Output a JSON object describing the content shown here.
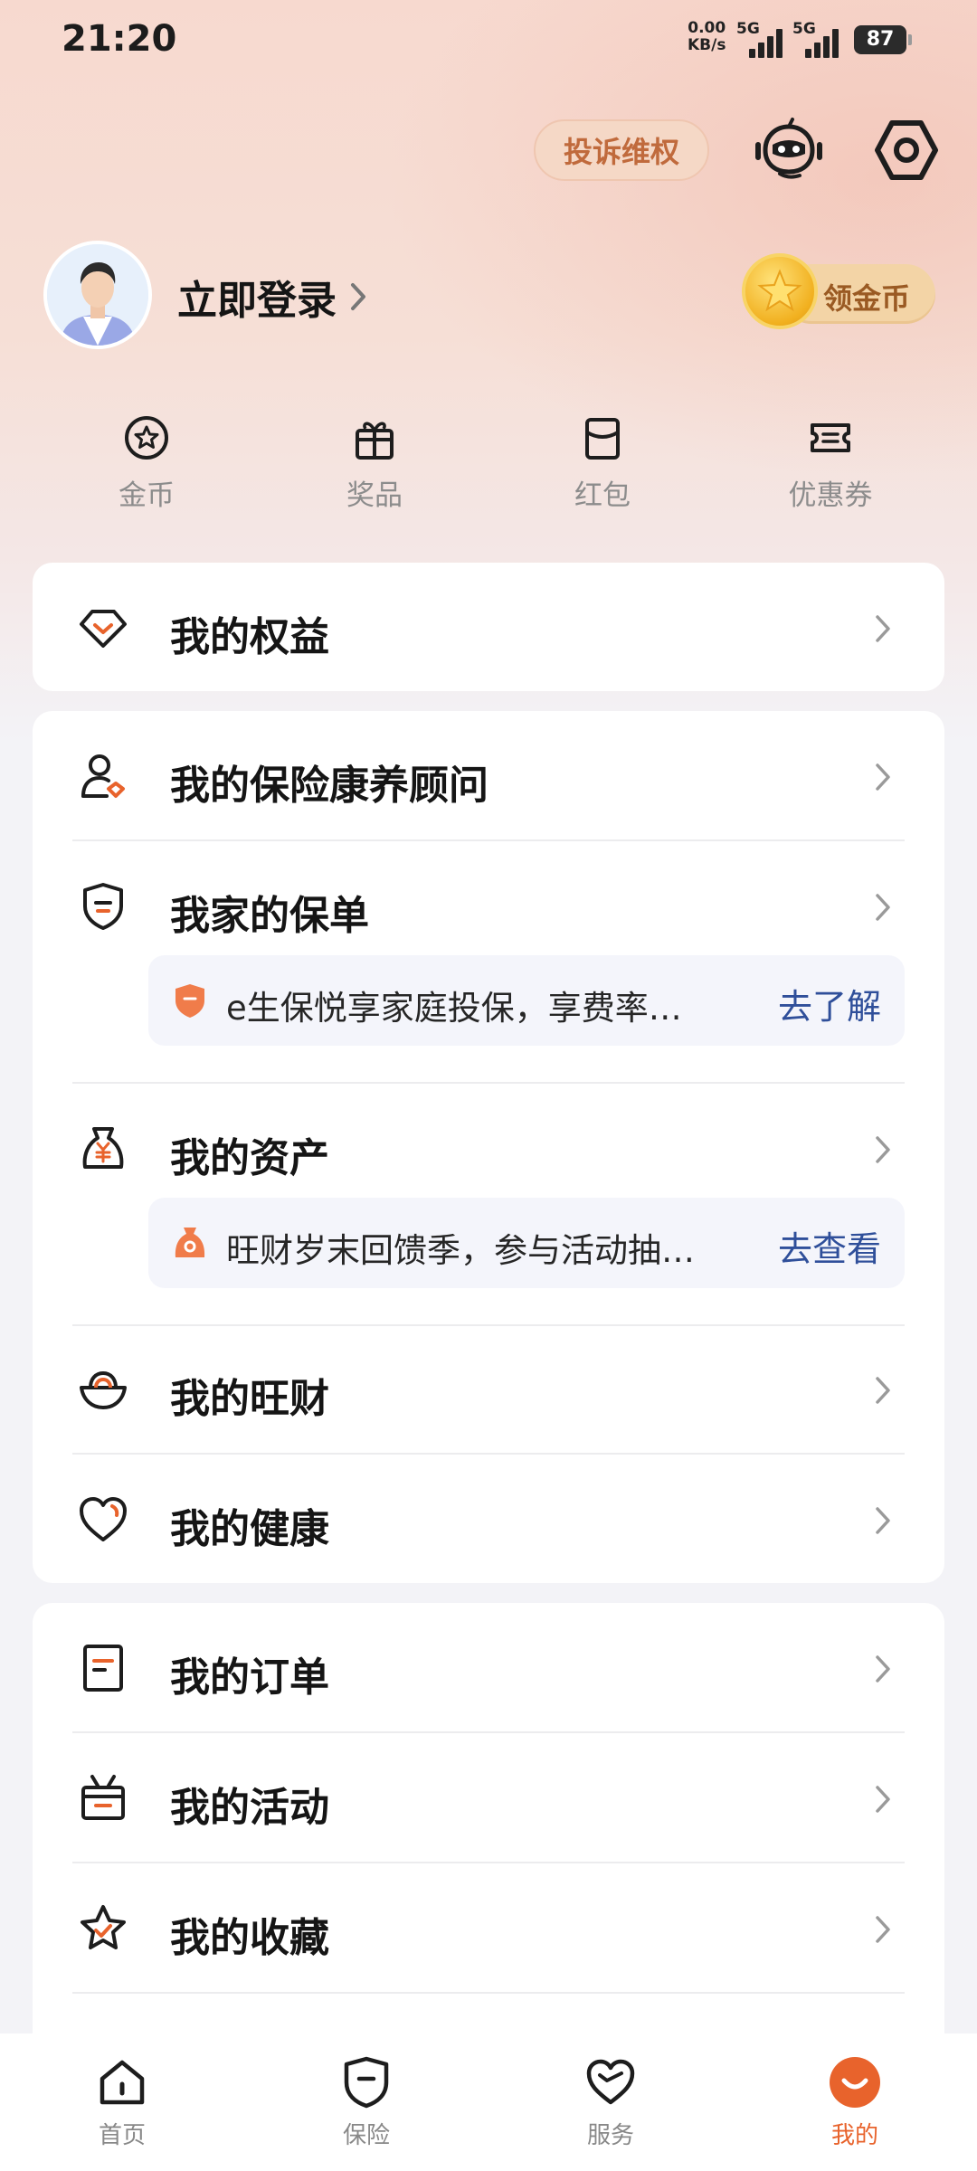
{
  "status": {
    "time": "21:20",
    "speed_top": "0.00",
    "speed_unit": "KB/s",
    "sim1": "5G",
    "sim2": "5G",
    "battery": "87"
  },
  "header": {
    "complaint_label": "投诉维权"
  },
  "profile": {
    "login_label": "立即登录",
    "coin_label": "领金币"
  },
  "quick": [
    {
      "label": "金币",
      "icon": "coin-icon"
    },
    {
      "label": "奖品",
      "icon": "gift-icon"
    },
    {
      "label": "红包",
      "icon": "red-envelope-icon"
    },
    {
      "label": "优惠券",
      "icon": "coupon-icon"
    }
  ],
  "rights": {
    "label": "我的权益"
  },
  "menu1": {
    "advisor": "我的保险康养顾问",
    "policy": "我家的保单",
    "policy_promo": {
      "text": "e生保悦享家庭投保，享费率…",
      "link": "去了解"
    },
    "assets": "我的资产",
    "assets_promo": {
      "text": "旺财岁末回馈季，参与活动抽…",
      "link": "去查看"
    },
    "wangcai": "我的旺财",
    "health": "我的健康"
  },
  "menu2": {
    "orders": "我的订单",
    "activities": "我的活动",
    "favorites": "我的收藏"
  },
  "tabs": [
    {
      "label": "首页"
    },
    {
      "label": "保险"
    },
    {
      "label": "服务"
    },
    {
      "label": "我的"
    }
  ],
  "colors": {
    "accent": "#e8632c",
    "link": "#2f4f9a"
  }
}
